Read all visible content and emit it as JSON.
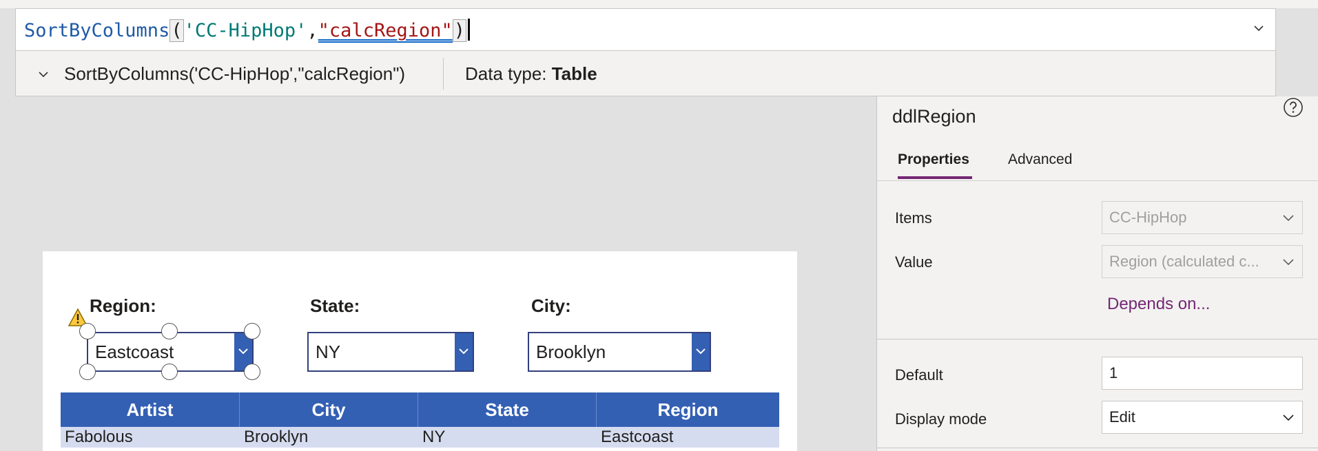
{
  "formula": {
    "function": "SortByColumns",
    "open_paren": "(",
    "arg1": "'CC-HipHop'",
    "comma": ",",
    "arg2": "\"calcRegion\"",
    "close_paren": ")"
  },
  "result": {
    "expression": "SortByColumns('CC-HipHop',\"calcRegion\")",
    "type_label": "Data type: ",
    "type_value": "Table"
  },
  "panel": {
    "control_name": "ddlRegion",
    "tabs": [
      {
        "label": "Properties",
        "active": true
      },
      {
        "label": "Advanced",
        "active": false
      }
    ],
    "items_label": "Items",
    "items_value": "CC-HipHop",
    "value_label": "Value",
    "value_value": "Region (calculated c...",
    "depends_link": "Depends on...",
    "default_label": "Default",
    "default_value": "1",
    "display_mode_label": "Display mode",
    "display_mode_value": "Edit"
  },
  "screen": {
    "region_label": "Region:",
    "region_value": "Eastcoast",
    "state_label": "State:",
    "state_value": "NY",
    "city_label": "City:",
    "city_value": "Brooklyn",
    "table": {
      "headers": [
        "Artist",
        "City",
        "State",
        "Region"
      ],
      "rows": [
        [
          "Fabolous",
          "Brooklyn",
          "NY",
          "Eastcoast"
        ]
      ]
    }
  },
  "colors": {
    "accent_purple": "#742774",
    "header_blue": "#3460b3",
    "warning_yellow": "#ffc83d"
  }
}
